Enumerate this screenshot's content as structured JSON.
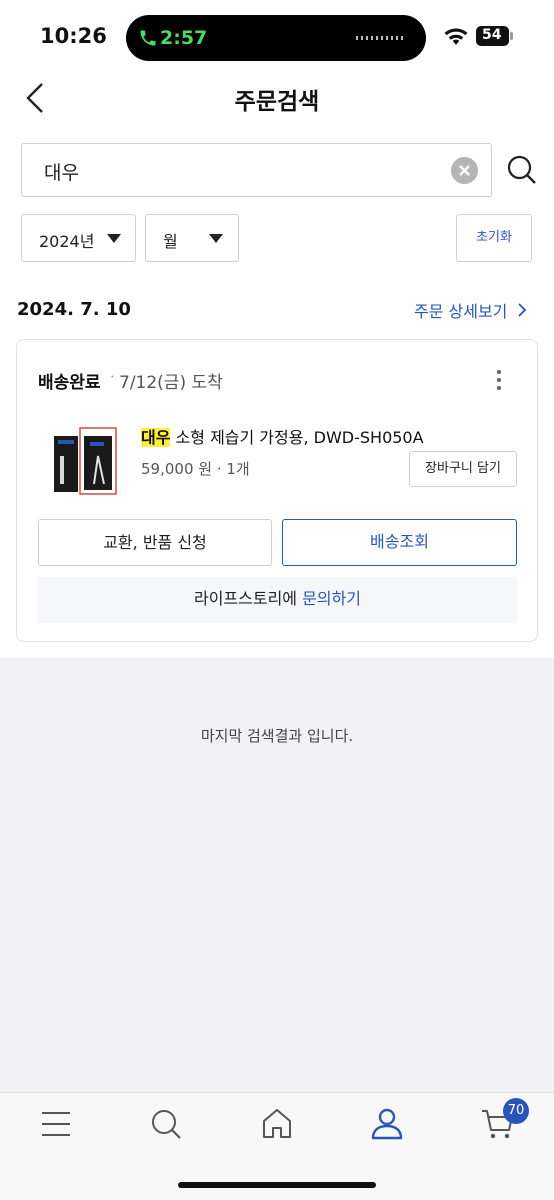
{
  "status_bar": {
    "time": "10:26",
    "call_time": "2:57",
    "battery": "54"
  },
  "header": {
    "title": "주문검색"
  },
  "search": {
    "value": "대우"
  },
  "filters": {
    "year": "2024년",
    "month": "월",
    "reset_label": "초기화"
  },
  "order": {
    "date": "2024. 7. 10",
    "detail_link": "주문 상세보기",
    "status": "배송완료",
    "separator": "·",
    "arrival": "7/12(금) 도착",
    "product": {
      "highlight": "대우",
      "name_rest": " 소형 제습기 가정용, DWD-SH050A",
      "price_qty": "59,000 원 · 1개",
      "cart_label": "장바구니 담기"
    },
    "exchange_label": "교환, 반품 신청",
    "track_label": "배송조회",
    "inquiry_text": "라이프스토리에 ",
    "inquiry_link": "문의하기"
  },
  "end_message": "마지막 검색결과 입니다.",
  "bottom_nav": {
    "cart_count": "70",
    "items": [
      "menu-icon",
      "search-icon",
      "home-icon",
      "user-icon",
      "cart-icon"
    ]
  },
  "colors": {
    "accent": "#2a55b8",
    "highlight": "#ffef3a",
    "call_green": "#4cd964"
  }
}
